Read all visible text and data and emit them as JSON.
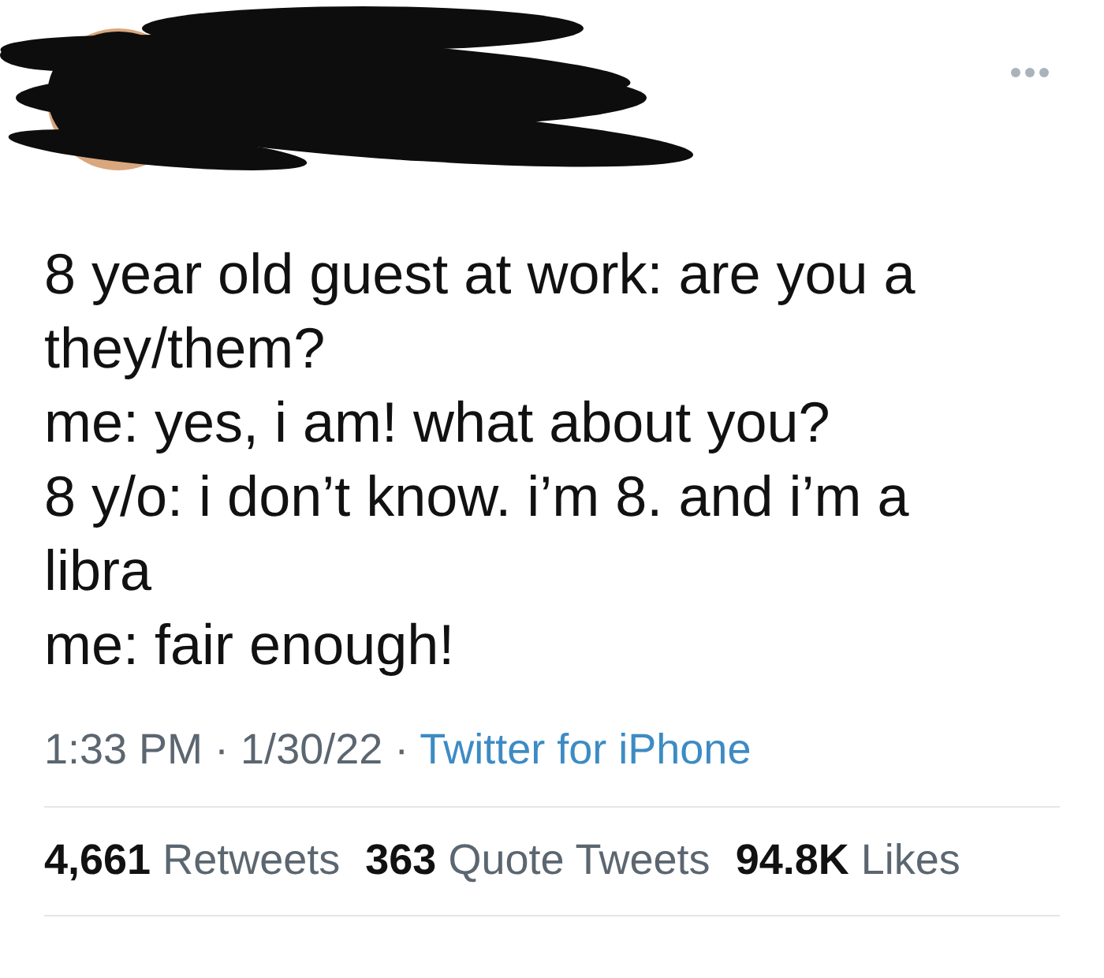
{
  "tweet": {
    "text_lines": [
      "8 year old guest at work: are you a",
      "they/them?",
      "me: yes, i am! what about you?",
      "8 y/o: i don’t know. i’m 8. and i’m a",
      "libra",
      "me: fair enough!"
    ],
    "timestamp": "1:33 PM · 1/30/22 ·",
    "source": "Twitter for iPhone",
    "stats": [
      "**4,661** Retweets",
      "**363** Quote Tweets",
      "**94.8K** Likes"
    ]
  }
}
